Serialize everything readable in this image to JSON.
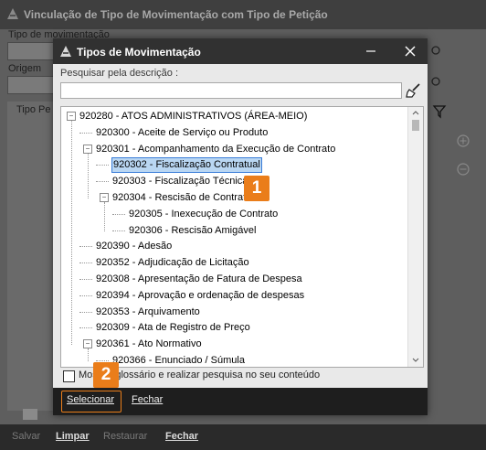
{
  "back_window": {
    "title": "Vinculação de Tipo de Movimentação com Tipo de Petição",
    "tipo_label": "Tipo de movimentação",
    "origem_label": "Origem",
    "table_header": "Tipo Pe",
    "footer_buttons": [
      "Salvar",
      "Limpar",
      "Restaurar",
      "Fechar"
    ]
  },
  "dialog": {
    "title": "Tipos de Movimentação",
    "search_label": "Pesquisar pela descrição :",
    "search_value": "",
    "tree": [
      {
        "label": "920280 - ATOS ADMINISTRATIVOS (ÁREA-MEIO)",
        "level": 0,
        "toggle": "−"
      },
      {
        "label": "920300 - Aceite de Serviço ou Produto",
        "level": 1,
        "toggle": ""
      },
      {
        "label": "920301 - Acompanhamento da Execução de Contrato",
        "level": 1,
        "toggle": "−"
      },
      {
        "label": "920302 - Fiscalização Contratual",
        "level": 2,
        "toggle": "",
        "selected": true
      },
      {
        "label": "920303 - Fiscalização Técnica",
        "level": 2,
        "toggle": ""
      },
      {
        "label": "920304 - Rescisão de Contrato",
        "level": 2,
        "toggle": "−"
      },
      {
        "label": "920305 - Inexecução de Contrato",
        "level": 3,
        "toggle": ""
      },
      {
        "label": "920306 - Rescisão Amigável",
        "level": 3,
        "toggle": ""
      },
      {
        "label": "920390 - Adesão",
        "level": 1,
        "toggle": ""
      },
      {
        "label": "920352 - Adjudicação de Licitação",
        "level": 1,
        "toggle": ""
      },
      {
        "label": "920308 - Apresentação de Fatura de Despesa",
        "level": 1,
        "toggle": ""
      },
      {
        "label": "920394 - Aprovação e ordenação de despesas",
        "level": 1,
        "toggle": ""
      },
      {
        "label": "920353 - Arquivamento",
        "level": 1,
        "toggle": ""
      },
      {
        "label": "920309 - Ata de Registro de Preço",
        "level": 1,
        "toggle": ""
      },
      {
        "label": "920361 - Ato Normativo",
        "level": 1,
        "toggle": "−"
      },
      {
        "label": "920366 - Enunciado / Súmula",
        "level": 2,
        "toggle": ""
      }
    ],
    "checkbox_label": "Mostrar glossário e realizar pesquisa no seu conteúdo",
    "select_button": "Selecionar",
    "close_button": "Fechar"
  },
  "badges": [
    "1",
    "2"
  ],
  "colors": {
    "badge": "#ea7d1a",
    "selection": "#b9d6f2",
    "dialog_title": "#313131"
  }
}
